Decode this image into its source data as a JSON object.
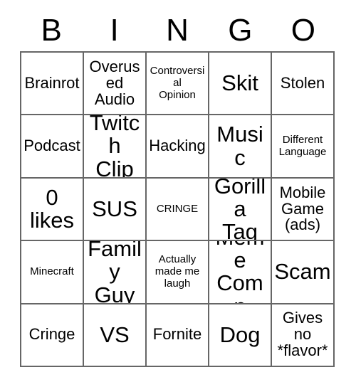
{
  "card": {
    "title": "BINGO",
    "headers": [
      "B",
      "I",
      "N",
      "G",
      "O"
    ],
    "colors": {
      "background": "#ffffff",
      "text": "#000000",
      "border": "#666666"
    },
    "rows": [
      [
        {
          "label": "Brainrot",
          "size": "md"
        },
        {
          "label": "Overused\nAudio",
          "size": "md"
        },
        {
          "label": "Controversial\nOpinion",
          "size": "sm"
        },
        {
          "label": "Skit",
          "size": "lg"
        },
        {
          "label": "Stolen",
          "size": "md"
        }
      ],
      [
        {
          "label": "Podcast",
          "size": "md"
        },
        {
          "label": "Twitch\nClip",
          "size": "lg"
        },
        {
          "label": "Hacking",
          "size": "md"
        },
        {
          "label": "Music",
          "size": "lg"
        },
        {
          "label": "Different\nLanguage",
          "size": "sm"
        }
      ],
      [
        {
          "label": "0\nlikes",
          "size": "lg"
        },
        {
          "label": "SUS",
          "size": "lg"
        },
        {
          "label": "CRINGE",
          "size": "sm"
        },
        {
          "label": "Gorilla\nTag",
          "size": "lg"
        },
        {
          "label": "Mobile\nGame\n(ads)",
          "size": "md"
        }
      ],
      [
        {
          "label": "Minecraft",
          "size": "sm"
        },
        {
          "label": "Family\nGuy",
          "size": "lg"
        },
        {
          "label": "Actually\nmade me\nlaugh",
          "size": "sm"
        },
        {
          "label": "Meme\nComp",
          "size": "lg"
        },
        {
          "label": "Scam",
          "size": "lg"
        }
      ],
      [
        {
          "label": "Cringe",
          "size": "md"
        },
        {
          "label": "VS",
          "size": "lg"
        },
        {
          "label": "Fornite",
          "size": "md"
        },
        {
          "label": "Dog",
          "size": "lg"
        },
        {
          "label": "Gives\nno\n*flavor*",
          "size": "md"
        }
      ]
    ]
  }
}
